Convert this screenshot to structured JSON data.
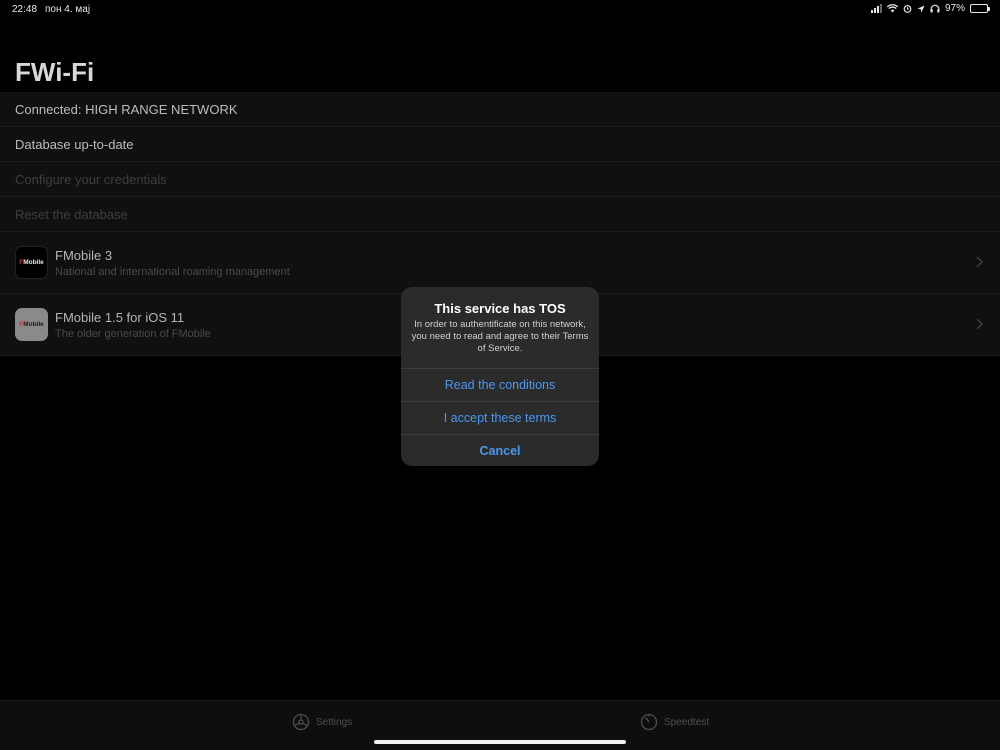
{
  "status_bar": {
    "time": "22:48",
    "date": "пон 4. мај",
    "battery_percent": "97%",
    "battery_level": 0.97,
    "icons": [
      "signal-icon",
      "wifi-icon",
      "alarm-icon",
      "location-icon",
      "headphones-icon",
      "battery-icon"
    ]
  },
  "page": {
    "title": "FWi-Fi"
  },
  "list": {
    "connected": "Connected: HIGH RANGE NETWORK",
    "database": "Database up-to-date",
    "configure": "Configure your credentials",
    "reset": "Reset the database"
  },
  "apps": [
    {
      "name": "FMobile 3",
      "subtitle": "National and international roaming management",
      "icon_text": "Mobile"
    },
    {
      "name": "FMobile 1.5 for iOS 11",
      "subtitle": "The older generation of FMobile",
      "icon_text": "Mobile"
    }
  ],
  "alert": {
    "title": "This service has TOS",
    "message": "In order to authentificate on this network, you need to read and agree to their Terms of Service.",
    "buttons": {
      "read": "Read the conditions",
      "accept": "I accept these terms",
      "cancel": "Cancel"
    }
  },
  "tabs": {
    "settings": "Settings",
    "speedtest": "Speedtest"
  },
  "colors": {
    "accent": "#4b96f2",
    "background": "#000000",
    "battery": "#35c759"
  }
}
